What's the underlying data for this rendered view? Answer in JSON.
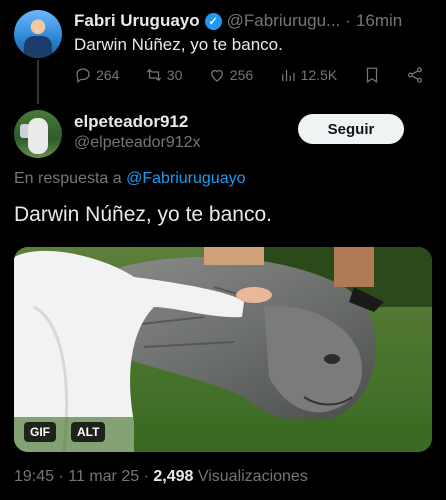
{
  "parent_tweet": {
    "name": "Fabri Uruguayo",
    "handle": "@Fabriurugu...",
    "separator": "·",
    "time": "16min",
    "text": "Darwin Núñez, yo te banco.",
    "actions": {
      "reply": "264",
      "retweet": "30",
      "like": "256",
      "views": "12.5K"
    }
  },
  "main_tweet": {
    "name": "elpeteador912",
    "handle": "@elpeteador912x",
    "follow_label": "Seguir",
    "reply_prefix": "En respuesta a ",
    "reply_mention": "@Fabriuruguayo",
    "text": "Darwin Núñez, yo te banco.",
    "media": {
      "badge_gif": "GIF",
      "badge_alt": "ALT"
    },
    "meta": {
      "time": "19:45",
      "dot1": " · ",
      "date": "11 mar 25",
      "dot2": " · ",
      "views_count": "2,498",
      "views_label": " Visualizaciones"
    }
  },
  "colors": {
    "background": "#000000",
    "accent": "#1d9bf0",
    "muted": "#71767b",
    "text": "#e7e9ea"
  }
}
